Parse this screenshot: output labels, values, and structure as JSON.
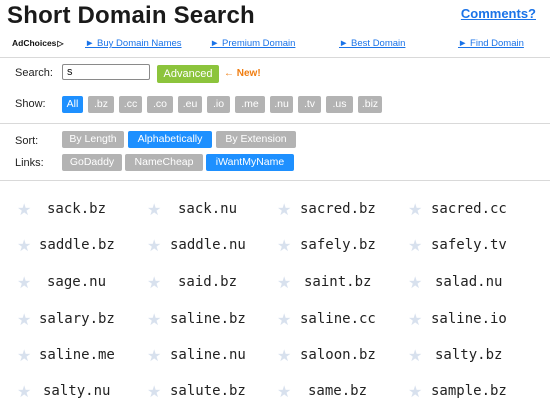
{
  "header": {
    "title": "Short Domain Search",
    "comments_link": "Comments?"
  },
  "ads": {
    "adchoices_label": "AdChoices",
    "links": [
      "► Buy Domain Names",
      "► Premium Domain",
      "► Best Domain",
      "► Find Domain"
    ]
  },
  "search": {
    "label": "Search:",
    "value": "s",
    "advanced_label": "Advanced",
    "new_badge": "← New!"
  },
  "show": {
    "label": "Show:",
    "options": [
      "All",
      ".bz",
      ".cc",
      ".co",
      ".eu",
      ".io",
      ".me",
      ".nu",
      ".tv",
      ".us",
      ".biz"
    ],
    "selected": "All"
  },
  "sort": {
    "label": "Sort:",
    "options": [
      "By Length",
      "Alphabetically",
      "By Extension"
    ],
    "selected": "Alphabetically"
  },
  "links": {
    "label": "Links:",
    "options": [
      "GoDaddy",
      "NameCheap",
      "iWantMyName"
    ],
    "selected": "iWantMyName"
  },
  "results": [
    [
      "sack.bz",
      "sack.nu",
      "sacred.bz",
      "sacred.cc"
    ],
    [
      "saddle.bz",
      "saddle.nu",
      "safely.bz",
      "safely.tv"
    ],
    [
      "sage.nu",
      "said.bz",
      "saint.bz",
      "salad.nu"
    ],
    [
      "salary.bz",
      "saline.bz",
      "saline.cc",
      "saline.io"
    ],
    [
      "saline.me",
      "saline.nu",
      "saloon.bz",
      "salty.bz"
    ],
    [
      "salty.nu",
      "salute.bz",
      "same.bz",
      "sample.bz"
    ]
  ],
  "colors": {
    "accent": "#1e90ff",
    "chip_off": "#b3b3b3",
    "advanced": "#8cc43c",
    "new": "#f07d10",
    "link": "#1a73e8",
    "star": "#d8e1ee"
  }
}
